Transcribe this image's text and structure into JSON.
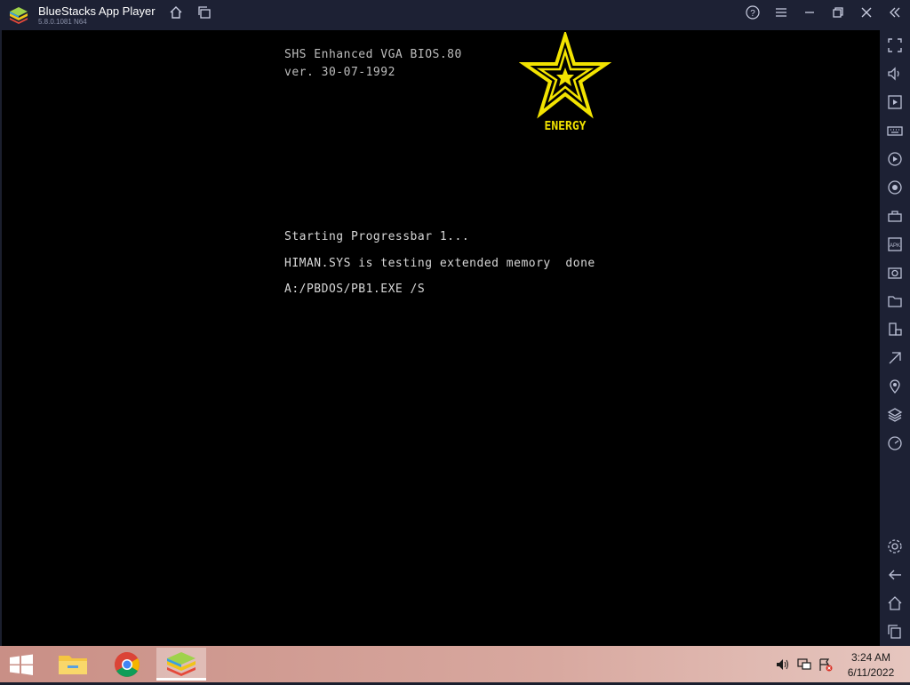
{
  "window": {
    "title": "BlueStacks App Player",
    "version": "5.8.0.1081 N64"
  },
  "titlebar_icons": [
    "home-icon",
    "multi-instance-icon",
    "help-icon",
    "menu-icon",
    "minimize-icon",
    "restore-icon",
    "close-icon",
    "collapse-sidebar-icon"
  ],
  "bios": {
    "header_line1": "SHS Enhanced VGA BIOS.80",
    "header_line2": "ver. 30-07-1992",
    "logo_text": "ENERGY",
    "line1": "Starting Progressbar 1...",
    "line2": "HIMAN.SYS is testing extended memory  done",
    "line3": "A:/PBDOS/PB1.EXE /S",
    "logo_color": "#f2e300"
  },
  "sidebar_icons": [
    "fullscreen-icon",
    "volume-icon",
    "media-icon",
    "keyboard-icon",
    "macro-icon",
    "record-icon",
    "gamepad-icon",
    "apk-icon",
    "screenshot-icon",
    "folder-icon",
    "rotate-icon",
    "eco-mode-icon",
    "location-icon",
    "layers-icon",
    "performance-icon",
    "settings-icon",
    "back-icon",
    "home-icon",
    "recent-apps-icon"
  ],
  "taskbar": {
    "apps": [
      "file-explorer",
      "chrome",
      "bluestacks"
    ],
    "time": "3:24 AM",
    "date": "6/11/2022"
  }
}
